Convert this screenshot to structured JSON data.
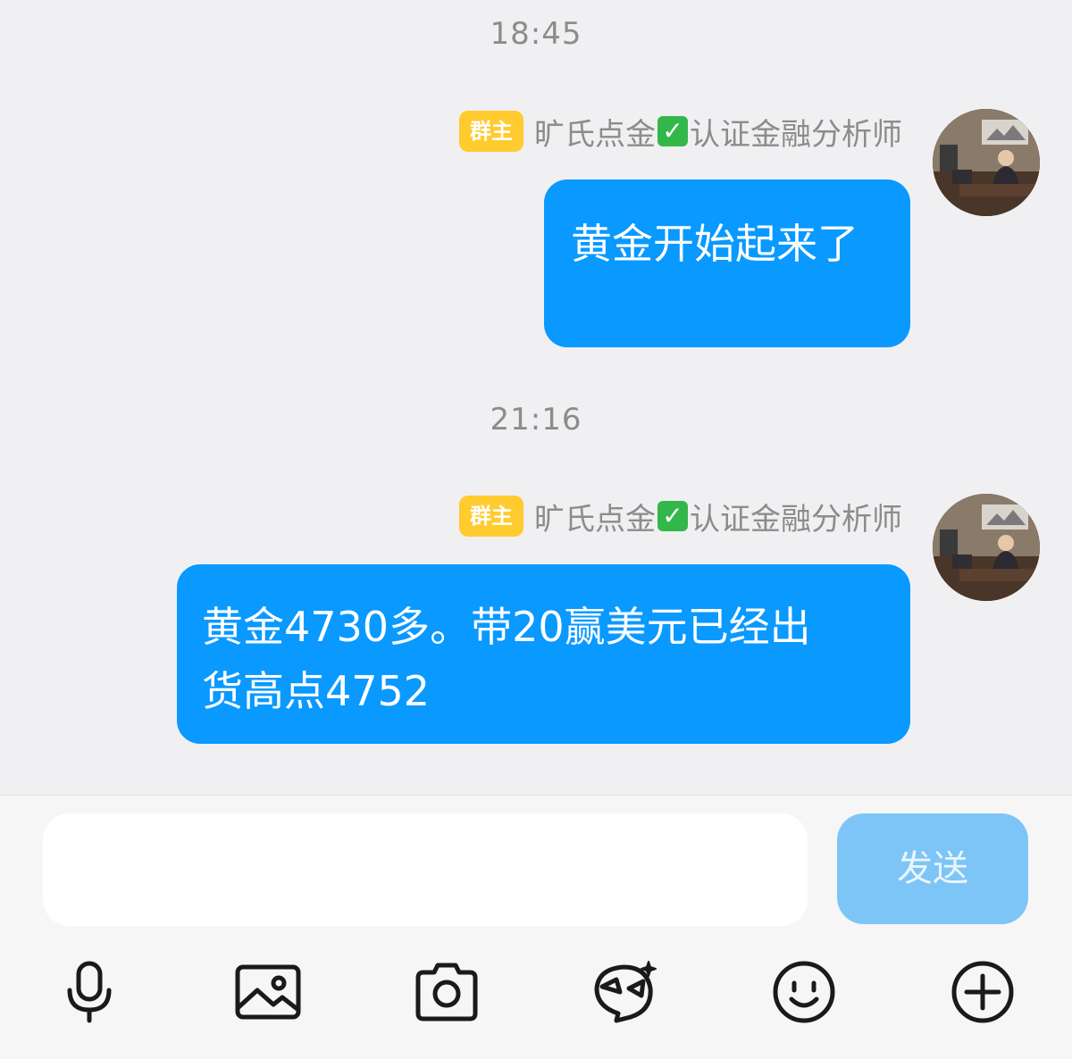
{
  "messages": [
    {
      "time": "18:45",
      "sender_badge": "群主",
      "sender_name_before": "旷氏点金",
      "sender_name_after": "认证金融分析师",
      "verified_icon": "check-mark-icon",
      "text": "黄金开始起来了"
    },
    {
      "time": "21:16",
      "sender_badge": "群主",
      "sender_name_before": "旷氏点金",
      "sender_name_after": "认证金融分析师",
      "verified_icon": "check-mark-icon",
      "text_line1": "黄金4730多。带20赢美元已经出",
      "text_line2": "货高点4752"
    }
  ],
  "composer": {
    "placeholder": "",
    "send_label": "发送"
  },
  "toolbar": [
    "microphone-icon",
    "image-icon",
    "camera-icon",
    "sticker-icon",
    "emoji-icon",
    "plus-icon"
  ],
  "colors": {
    "bubble": "#0999ff",
    "send_disabled": "#7dc5f6",
    "badge": "#ffcb2f",
    "background": "#f0f0f2"
  }
}
